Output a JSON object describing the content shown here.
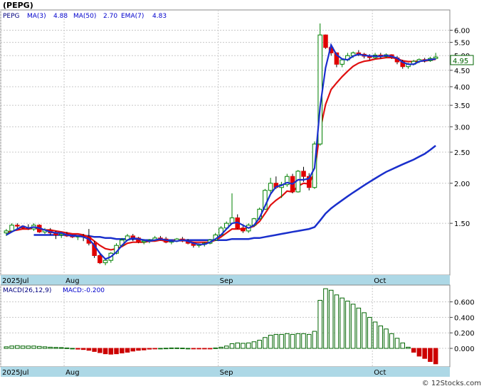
{
  "header": {
    "ticker": "(PEPG)",
    "symbol": "PEPG",
    "ma3_label": "MA(3)",
    "ma3_value": "4.88",
    "ma50_label": "MA(50)",
    "ma50_value": "2.70",
    "ema7_label": "EMA(7)",
    "ema7_value": "4.83"
  },
  "price_badge": "4.95",
  "macd_header": {
    "label": "MACD(26,12,9)",
    "value_label": "MACD:-0.200"
  },
  "watermark": "© 12Stocks.com",
  "colors": {
    "up_fill": "#ffffff",
    "up_stroke": "#008000",
    "down_fill": "#e00000",
    "ma_line": "#1a2fcc",
    "ema_line": "#e01010",
    "axis_band": "#add8e6",
    "hist_pos_stroke": "#006400",
    "hist_neg_fill": "#cc0000",
    "badge_text": "#006400"
  },
  "chart_data": [
    {
      "type": "candlestick",
      "scale": "log",
      "x_labels": [
        {
          "label": "2025Jul",
          "index": 0
        },
        {
          "label": "Aug",
          "index": 11
        },
        {
          "label": "Sep",
          "index": 39
        },
        {
          "label": "Oct",
          "index": 67
        }
      ],
      "y_ticks": [
        {
          "v": 6.0,
          "label": "6.00"
        },
        {
          "v": 5.5,
          "label": "5.50"
        },
        {
          "v": 5.0,
          "label": "5.00"
        },
        {
          "v": 4.5,
          "label": "4.50"
        },
        {
          "v": 4.0,
          "label": "4.00"
        },
        {
          "v": 3.5,
          "label": "3.50"
        },
        {
          "v": 3.0,
          "label": "3.00"
        },
        {
          "v": 2.5,
          "label": "2.50"
        },
        {
          "v": 2.0,
          "label": "2.00"
        },
        {
          "v": 1.5,
          "label": "1.50"
        }
      ],
      "ylim": [
        1.05,
        6.8
      ],
      "grid": true,
      "candles": [
        [
          1.4,
          1.44,
          1.37,
          1.42
        ],
        [
          1.42,
          1.5,
          1.41,
          1.48
        ],
        [
          1.48,
          1.5,
          1.44,
          1.47
        ],
        [
          1.47,
          1.48,
          1.44,
          1.45
        ],
        [
          1.45,
          1.49,
          1.43,
          1.44
        ],
        [
          1.44,
          1.5,
          1.42,
          1.48
        ],
        [
          1.48,
          1.49,
          1.4,
          1.41
        ],
        [
          1.41,
          1.45,
          1.39,
          1.43
        ],
        [
          1.43,
          1.45,
          1.38,
          1.4
        ],
        [
          1.4,
          1.42,
          1.34,
          1.38
        ],
        [
          1.38,
          1.41,
          1.35,
          1.39
        ],
        [
          1.39,
          1.41,
          1.36,
          1.37
        ],
        [
          1.37,
          1.38,
          1.35,
          1.36
        ],
        [
          1.36,
          1.38,
          1.33,
          1.37
        ],
        [
          1.37,
          1.39,
          1.32,
          1.36
        ],
        [
          1.36,
          1.44,
          1.28,
          1.3
        ],
        [
          1.3,
          1.32,
          1.17,
          1.19
        ],
        [
          1.19,
          1.22,
          1.12,
          1.13
        ],
        [
          1.13,
          1.17,
          1.11,
          1.15
        ],
        [
          1.15,
          1.22,
          1.13,
          1.21
        ],
        [
          1.21,
          1.3,
          1.2,
          1.28
        ],
        [
          1.28,
          1.35,
          1.27,
          1.33
        ],
        [
          1.33,
          1.39,
          1.32,
          1.37
        ],
        [
          1.37,
          1.39,
          1.32,
          1.35
        ],
        [
          1.35,
          1.36,
          1.3,
          1.31
        ],
        [
          1.31,
          1.34,
          1.29,
          1.32
        ],
        [
          1.32,
          1.34,
          1.3,
          1.33
        ],
        [
          1.33,
          1.37,
          1.32,
          1.35
        ],
        [
          1.35,
          1.37,
          1.33,
          1.34
        ],
        [
          1.34,
          1.36,
          1.3,
          1.31
        ],
        [
          1.31,
          1.33,
          1.29,
          1.32
        ],
        [
          1.32,
          1.35,
          1.31,
          1.34
        ],
        [
          1.34,
          1.36,
          1.31,
          1.32
        ],
        [
          1.32,
          1.34,
          1.29,
          1.3
        ],
        [
          1.3,
          1.31,
          1.26,
          1.28
        ],
        [
          1.28,
          1.3,
          1.26,
          1.29
        ],
        [
          1.29,
          1.31,
          1.27,
          1.3
        ],
        [
          1.3,
          1.34,
          1.29,
          1.33
        ],
        [
          1.33,
          1.4,
          1.32,
          1.38
        ],
        [
          1.38,
          1.47,
          1.37,
          1.45
        ],
        [
          1.45,
          1.52,
          1.44,
          1.5
        ],
        [
          1.5,
          1.86,
          1.49,
          1.56
        ],
        [
          1.56,
          1.6,
          1.44,
          1.45
        ],
        [
          1.45,
          1.49,
          1.4,
          1.42
        ],
        [
          1.42,
          1.5,
          1.4,
          1.48
        ],
        [
          1.48,
          1.56,
          1.46,
          1.55
        ],
        [
          1.55,
          1.68,
          1.54,
          1.66
        ],
        [
          1.66,
          1.92,
          1.65,
          1.9
        ],
        [
          1.9,
          2.08,
          1.86,
          2.0
        ],
        [
          2.0,
          2.1,
          1.92,
          1.94
        ],
        [
          1.94,
          2.02,
          1.8,
          1.98
        ],
        [
          1.98,
          2.14,
          1.95,
          2.1
        ],
        [
          2.1,
          2.14,
          1.86,
          1.88
        ],
        [
          1.88,
          2.2,
          1.87,
          2.18
        ],
        [
          2.18,
          2.25,
          2.02,
          2.1
        ],
        [
          2.1,
          2.15,
          1.9,
          1.94
        ],
        [
          1.94,
          2.7,
          1.92,
          2.65
        ],
        [
          2.65,
          6.3,
          2.62,
          5.8
        ],
        [
          5.8,
          5.82,
          5.25,
          5.3
        ],
        [
          5.3,
          5.4,
          5.0,
          5.1
        ],
        [
          5.1,
          5.12,
          4.6,
          4.7
        ],
        [
          4.7,
          4.9,
          4.6,
          4.85
        ],
        [
          4.85,
          5.1,
          4.8,
          5.0
        ],
        [
          5.0,
          5.15,
          4.92,
          5.1
        ],
        [
          5.1,
          5.2,
          4.98,
          5.05
        ],
        [
          5.05,
          5.1,
          4.9,
          4.98
        ],
        [
          4.98,
          5.05,
          4.85,
          4.93
        ],
        [
          4.93,
          5.1,
          4.88,
          5.02
        ],
        [
          5.02,
          5.1,
          4.9,
          4.97
        ],
        [
          4.97,
          5.08,
          4.92,
          5.03
        ],
        [
          5.03,
          5.05,
          4.88,
          4.92
        ],
        [
          4.92,
          4.98,
          4.7,
          4.78
        ],
        [
          4.78,
          4.85,
          4.55,
          4.62
        ],
        [
          4.62,
          4.75,
          4.55,
          4.7
        ],
        [
          4.7,
          4.85,
          4.66,
          4.8
        ],
        [
          4.8,
          4.9,
          4.74,
          4.86
        ],
        [
          4.86,
          4.92,
          4.76,
          4.82
        ],
        [
          4.82,
          4.96,
          4.78,
          4.9
        ],
        [
          4.9,
          5.1,
          4.86,
          4.95
        ]
      ],
      "series": [
        {
          "name": "MA(3)",
          "values": [
            1.38,
            1.41,
            1.44,
            1.47,
            1.45,
            1.46,
            1.45,
            1.43,
            1.41,
            1.4,
            1.4,
            1.38,
            1.37,
            1.37,
            1.36,
            1.34,
            1.28,
            1.21,
            1.16,
            1.18,
            1.22,
            1.28,
            1.33,
            1.35,
            1.34,
            1.33,
            1.32,
            1.33,
            1.34,
            1.33,
            1.32,
            1.32,
            1.33,
            1.32,
            1.3,
            1.29,
            1.29,
            1.31,
            1.34,
            1.38,
            1.44,
            1.5,
            1.51,
            1.48,
            1.45,
            1.48,
            1.56,
            1.7,
            1.85,
            1.95,
            1.97,
            2.01,
            1.99,
            2.05,
            2.05,
            2.07,
            2.23,
            3.46,
            4.58,
            5.4,
            5.03,
            4.88,
            4.85,
            4.98,
            5.05,
            5.01,
            4.99,
            4.98,
            4.97,
            5.01,
            4.97,
            4.91,
            4.77,
            4.7,
            4.7,
            4.79,
            4.83,
            4.86,
            4.88
          ]
        },
        {
          "name": "MA(50)",
          "values": [
            null,
            null,
            null,
            null,
            null,
            1.38,
            1.38,
            1.38,
            1.38,
            1.38,
            1.38,
            1.38,
            1.38,
            1.37,
            1.37,
            1.37,
            1.36,
            1.36,
            1.35,
            1.35,
            1.34,
            1.34,
            1.34,
            1.34,
            1.34,
            1.33,
            1.33,
            1.33,
            1.33,
            1.33,
            1.33,
            1.33,
            1.33,
            1.33,
            1.33,
            1.33,
            1.33,
            1.33,
            1.33,
            1.33,
            1.33,
            1.34,
            1.34,
            1.34,
            1.34,
            1.35,
            1.35,
            1.36,
            1.37,
            1.38,
            1.39,
            1.4,
            1.41,
            1.42,
            1.43,
            1.44,
            1.46,
            1.53,
            1.61,
            1.67,
            1.72,
            1.77,
            1.82,
            1.87,
            1.92,
            1.97,
            2.02,
            2.07,
            2.12,
            2.17,
            2.21,
            2.25,
            2.29,
            2.33,
            2.37,
            2.42,
            2.47,
            2.54,
            2.62
          ]
        },
        {
          "name": "EMA(7)",
          "values": [
            1.4,
            1.42,
            1.43,
            1.44,
            1.44,
            1.45,
            1.44,
            1.43,
            1.43,
            1.42,
            1.41,
            1.4,
            1.39,
            1.39,
            1.38,
            1.36,
            1.32,
            1.28,
            1.25,
            1.24,
            1.25,
            1.27,
            1.3,
            1.31,
            1.31,
            1.31,
            1.32,
            1.32,
            1.33,
            1.32,
            1.32,
            1.33,
            1.33,
            1.32,
            1.31,
            1.31,
            1.31,
            1.31,
            1.33,
            1.36,
            1.4,
            1.44,
            1.44,
            1.44,
            1.45,
            1.47,
            1.52,
            1.61,
            1.71,
            1.77,
            1.82,
            1.89,
            1.88,
            1.96,
            2.0,
            1.99,
            2.16,
            2.93,
            3.52,
            3.92,
            4.11,
            4.3,
            4.47,
            4.63,
            4.74,
            4.8,
            4.83,
            4.88,
            4.9,
            4.93,
            4.93,
            4.89,
            4.82,
            4.79,
            4.79,
            4.81,
            4.81,
            4.84,
            4.87
          ]
        }
      ],
      "price_label": 4.95
    },
    {
      "type": "bar",
      "name": "MACD(26,12,9)",
      "y_ticks": [
        {
          "v": 0.6,
          "label": "0.600"
        },
        {
          "v": 0.4,
          "label": "0.400"
        },
        {
          "v": 0.2,
          "label": "0.200"
        },
        {
          "v": 0.0,
          "label": "0.000"
        }
      ],
      "ylim": [
        -0.22,
        0.78
      ],
      "grid": true,
      "values": [
        0.02,
        0.03,
        0.035,
        0.03,
        0.03,
        0.03,
        0.025,
        0.02,
        0.015,
        0.012,
        0.01,
        0.005,
        0.0,
        -0.01,
        -0.015,
        -0.025,
        -0.04,
        -0.055,
        -0.07,
        -0.075,
        -0.07,
        -0.06,
        -0.05,
        -0.035,
        -0.025,
        -0.02,
        -0.01,
        -0.005,
        0.0,
        0.002,
        0.005,
        0.005,
        0.003,
        0.0,
        -0.003,
        -0.005,
        -0.005,
        -0.003,
        0.005,
        0.015,
        0.03,
        0.06,
        0.07,
        0.065,
        0.07,
        0.085,
        0.105,
        0.14,
        0.17,
        0.18,
        0.18,
        0.19,
        0.18,
        0.19,
        0.19,
        0.18,
        0.22,
        0.62,
        0.77,
        0.75,
        0.69,
        0.65,
        0.61,
        0.57,
        0.52,
        0.46,
        0.4,
        0.34,
        0.29,
        0.25,
        0.19,
        0.13,
        0.07,
        0.015,
        -0.05,
        -0.1,
        -0.13,
        -0.17,
        -0.2
      ]
    }
  ]
}
